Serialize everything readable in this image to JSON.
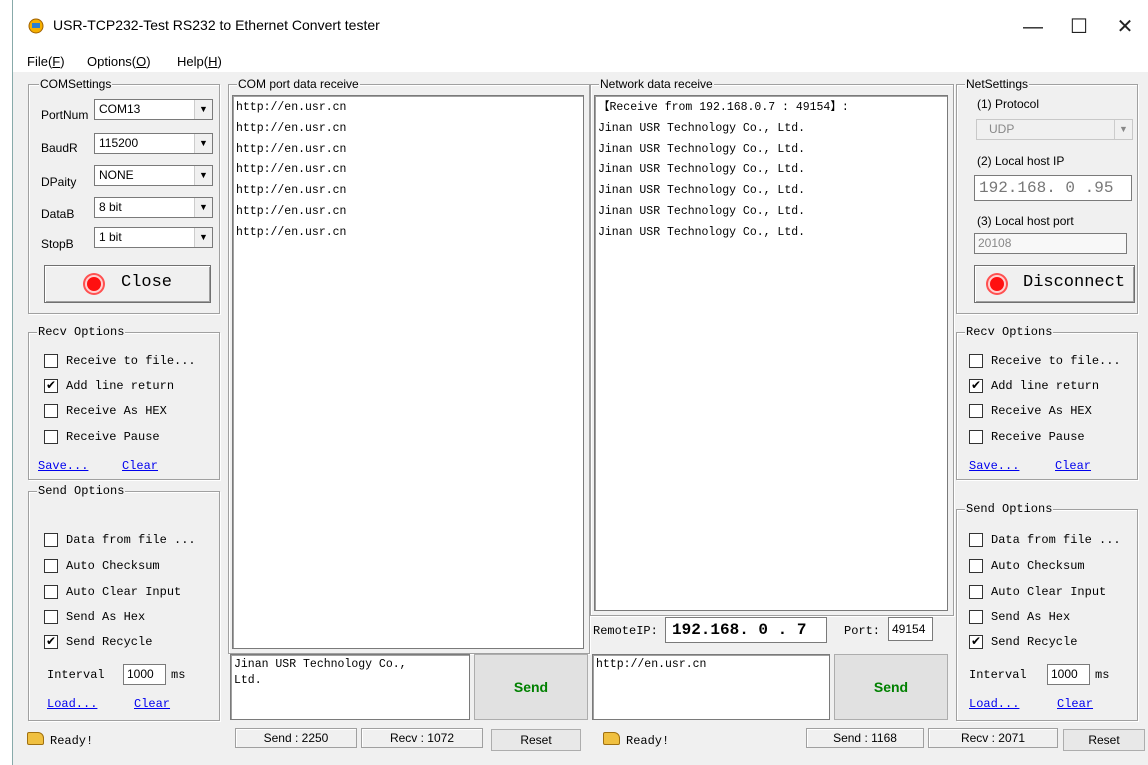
{
  "window": {
    "title": "USR-TCP232-Test  RS232 to Ethernet Convert tester",
    "minimize": "—",
    "maximize": "☐",
    "close": "✕"
  },
  "menu": [
    {
      "label": "File(",
      "key": "F",
      "end": ")"
    },
    {
      "label": "Options(",
      "key": "O",
      "end": ")"
    },
    {
      "label": "Help(",
      "key": "H",
      "end": ")"
    }
  ],
  "com_settings": {
    "legend": "COMSettings",
    "fields": [
      {
        "label": "PortNum",
        "value": "COM13"
      },
      {
        "label": "BaudR",
        "value": "115200"
      },
      {
        "label": "DPaity",
        "value": "NONE"
      },
      {
        "label": "DataB",
        "value": "8 bit"
      },
      {
        "label": "StopB",
        "value": "1 bit"
      }
    ],
    "button": "Close"
  },
  "recv_options_left": {
    "legend": "Recv Options",
    "checks": [
      {
        "label": "Receive to file...",
        "checked": false
      },
      {
        "label": "Add line return",
        "checked": true
      },
      {
        "label": "Receive As HEX",
        "checked": false
      },
      {
        "label": "Receive Pause",
        "checked": false
      }
    ],
    "save": "Save...",
    "clear": "Clear"
  },
  "send_options_left": {
    "legend": "Send Options",
    "checks": [
      {
        "label": "Data from file ...",
        "checked": false
      },
      {
        "label": "Auto Checksum",
        "checked": false
      },
      {
        "label": "Auto Clear Input",
        "checked": false
      },
      {
        "label": "Send As Hex",
        "checked": false
      },
      {
        "label": "Send Recycle",
        "checked": true
      }
    ],
    "interval_label": "Interval",
    "interval_value": "1000",
    "interval_unit": "ms",
    "load": "Load...",
    "clear": "Clear"
  },
  "com_receive": {
    "legend": "COM port data receive",
    "lines": [
      "http://en.usr.cn",
      "http://en.usr.cn",
      "http://en.usr.cn",
      "http://en.usr.cn",
      "http://en.usr.cn",
      "http://en.usr.cn",
      "http://en.usr.cn"
    ]
  },
  "com_send": {
    "text_line1": "Jinan USR Technology Co.,",
    "text_line2": "Ltd.",
    "button": "Send"
  },
  "net_receive": {
    "legend": "Network data receive",
    "lines": [
      "【Receive from 192.168.0.7 : 49154】:",
      "Jinan USR Technology Co., Ltd.",
      "Jinan USR Technology Co., Ltd.",
      "Jinan USR Technology Co., Ltd.",
      "Jinan USR Technology Co., Ltd.",
      "Jinan USR Technology Co., Ltd.",
      "Jinan USR Technology Co., Ltd."
    ]
  },
  "remote": {
    "ip_label": "RemoteIP:",
    "ip_value": "192.168. 0 . 7",
    "port_label": "Port:",
    "port_value": "49154"
  },
  "net_send": {
    "text": "http://en.usr.cn",
    "button": "Send"
  },
  "net_settings": {
    "legend": "NetSettings",
    "protocol_label": "(1) Protocol",
    "protocol_value": "UDP",
    "host_ip_label": "(2) Local host IP",
    "host_ip_value": "192.168. 0 .95",
    "host_port_label": "(3) Local host port",
    "host_port_value": "20108",
    "button": "Disconnect"
  },
  "recv_options_right": {
    "legend": "Recv Options",
    "checks": [
      {
        "label": "Receive to file...",
        "checked": false
      },
      {
        "label": "Add line return",
        "checked": true
      },
      {
        "label": "Receive As HEX",
        "checked": false
      },
      {
        "label": "Receive Pause",
        "checked": false
      }
    ],
    "save": "Save...",
    "clear": "Clear"
  },
  "send_options_right": {
    "legend": "Send Options",
    "checks": [
      {
        "label": "Data from file ...",
        "checked": false
      },
      {
        "label": "Auto Checksum",
        "checked": false
      },
      {
        "label": "Auto Clear Input",
        "checked": false
      },
      {
        "label": "Send As Hex",
        "checked": false
      },
      {
        "label": "Send Recycle",
        "checked": true
      }
    ],
    "interval_label": "Interval",
    "interval_value": "1000",
    "interval_unit": "ms",
    "load": "Load...",
    "clear": "Clear"
  },
  "status": {
    "left_ready": "Ready!",
    "left_send": "Send : 2250",
    "left_recv": "Recv : 1072",
    "left_reset": "Reset",
    "right_ready": "Ready!",
    "right_send": "Send : 1168",
    "right_recv": "Recv : 2071",
    "right_reset": "Reset"
  }
}
